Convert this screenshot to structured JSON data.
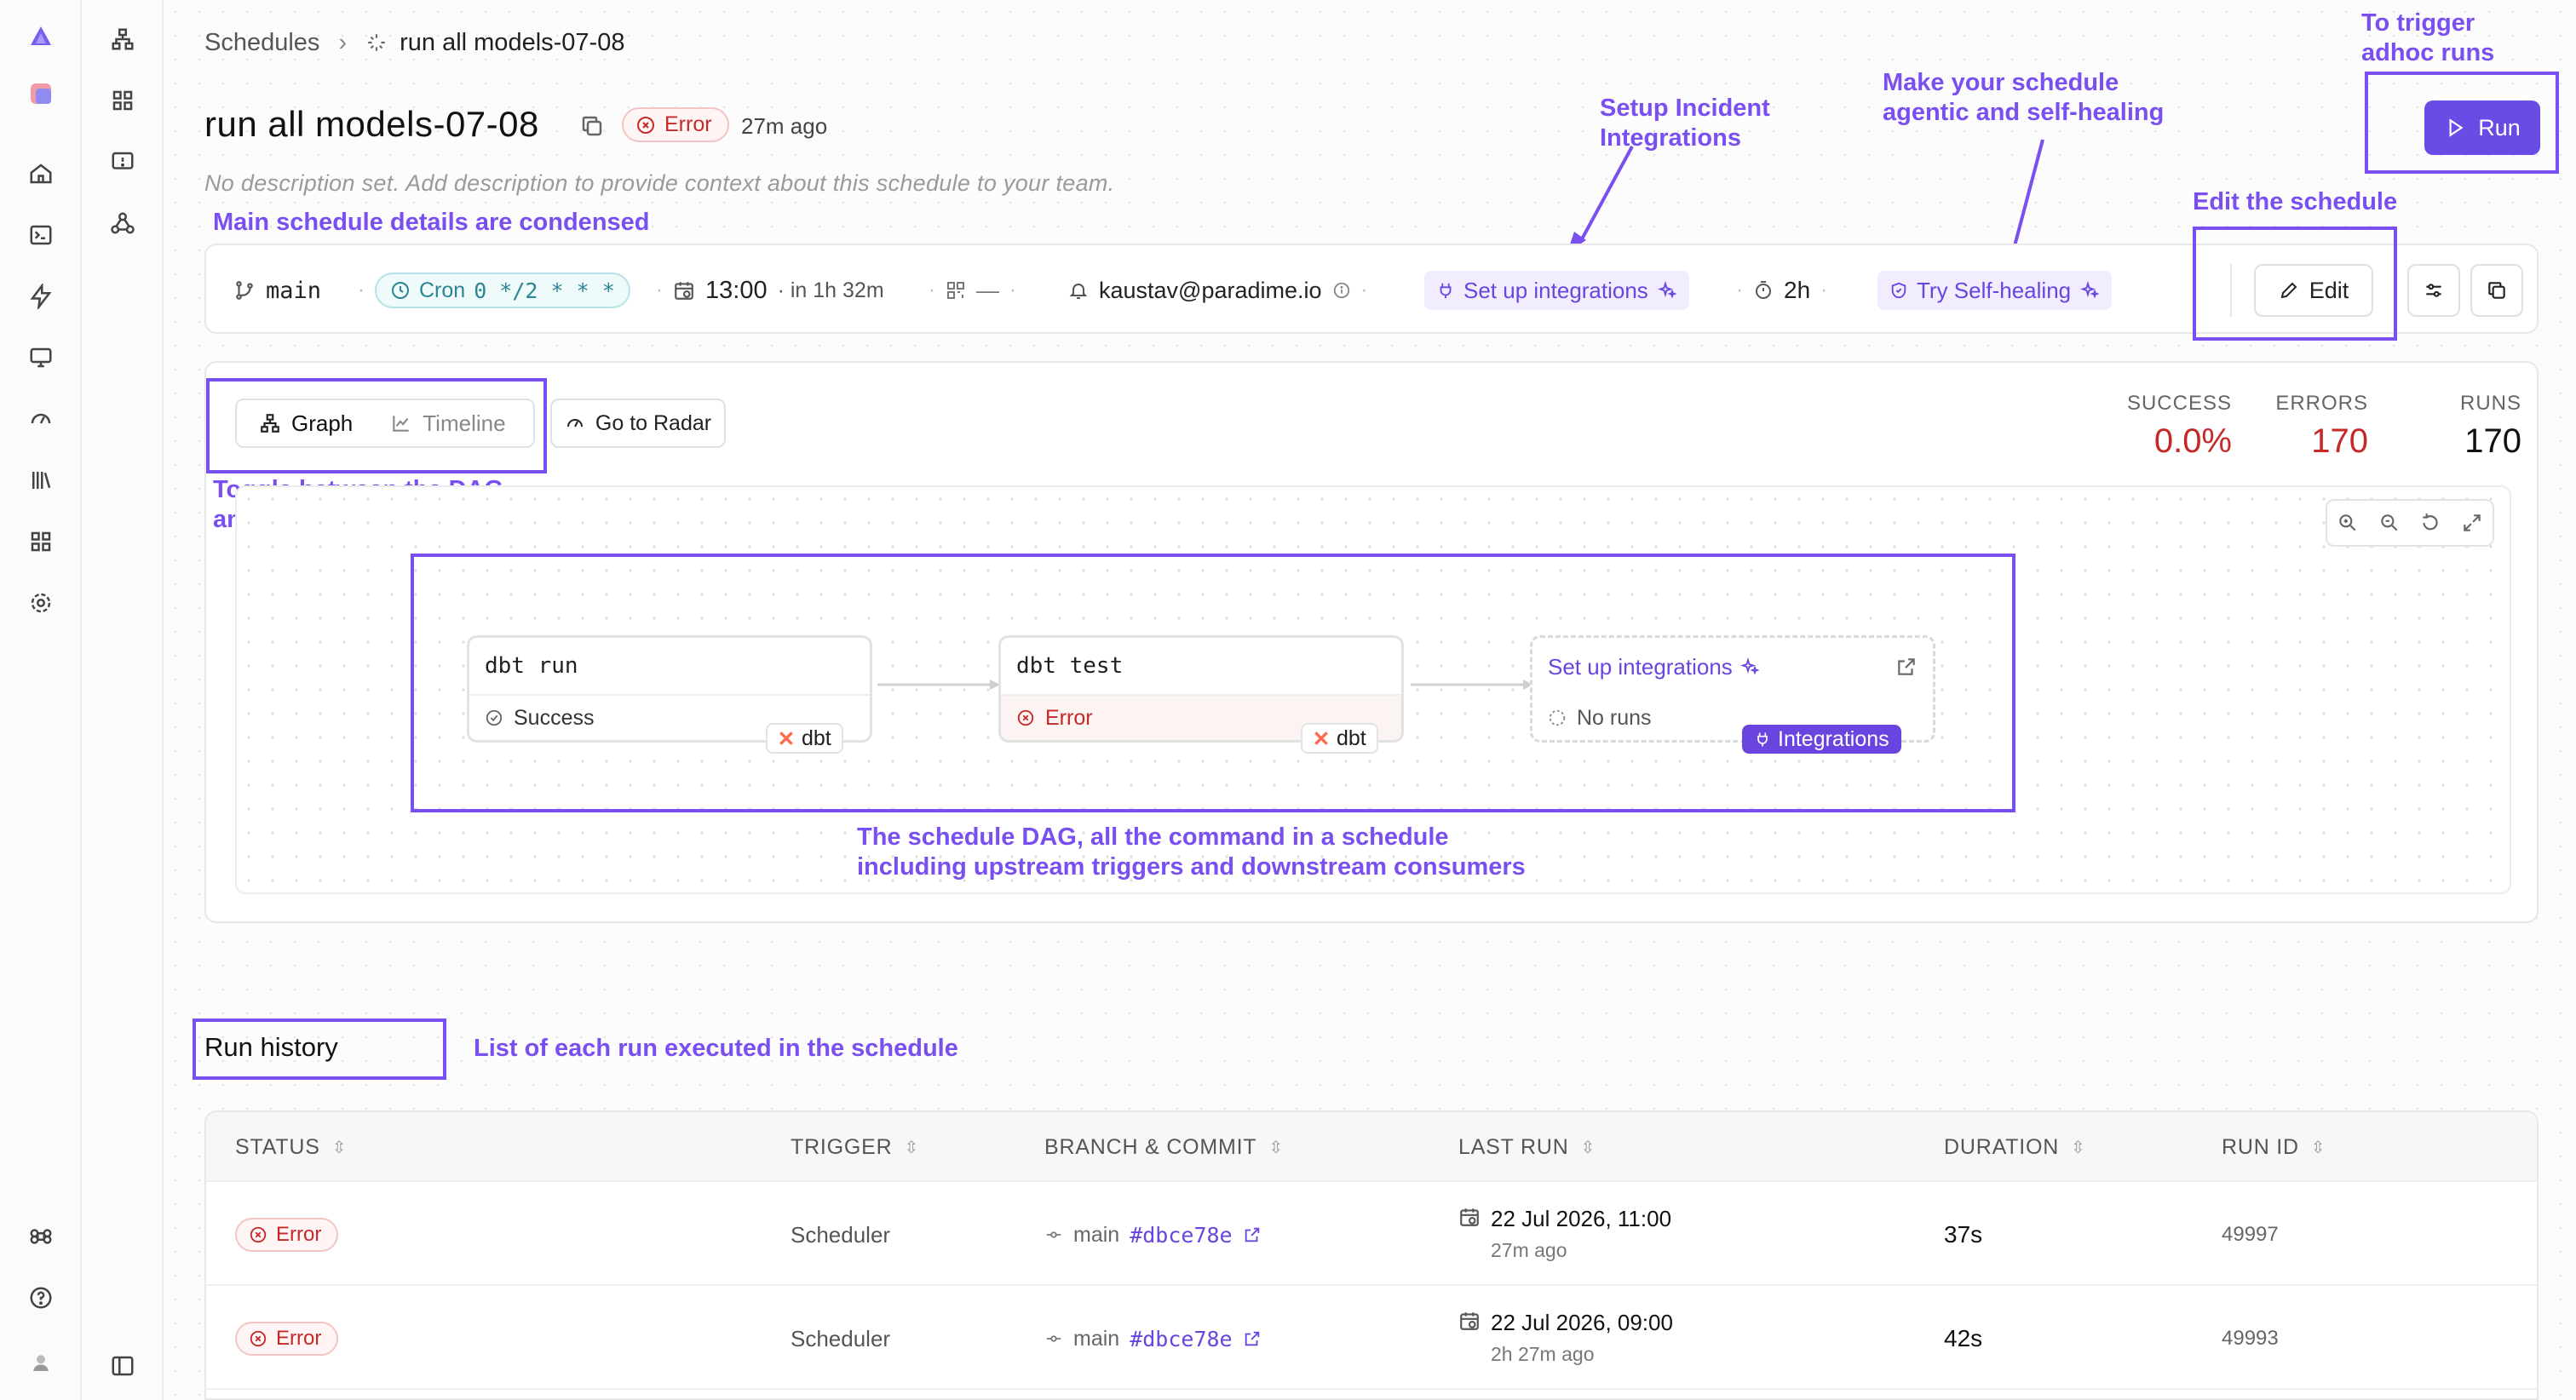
{
  "breadcrumb": {
    "root": "Schedules",
    "current": "run all models-07-08"
  },
  "header": {
    "title": "run all models-07-08",
    "status": "Error",
    "ago": "27m ago",
    "description": "No description set. Add description to provide context about this schedule to your team.",
    "run_label": "Run"
  },
  "details": {
    "branch": "main",
    "cron_label": "Cron",
    "cron_expr": "0 */2 * * *",
    "time": "13:00",
    "next": "· in 1h 32m",
    "commit": "—",
    "owner": "kaustav@paradime.io",
    "integrations": "Set up integrations",
    "timeout": "2h",
    "self_healing": "Try Self-healing",
    "edit_label": "Edit"
  },
  "graph": {
    "toggle_graph": "Graph",
    "toggle_timeline": "Timeline",
    "radar": "Go to Radar",
    "stats": [
      {
        "label": "SUCCESS",
        "value": "0.0%",
        "color": "#c62828"
      },
      {
        "label": "ERRORS",
        "value": "170",
        "color": "#c62828"
      },
      {
        "label": "RUNS",
        "value": "170",
        "color": "#111111"
      }
    ],
    "nodes": [
      {
        "title": "dbt run",
        "status": "Success",
        "tag": "dbt"
      },
      {
        "title": "dbt test",
        "status": "Error",
        "tag": "dbt"
      },
      {
        "title": "Set up integrations",
        "status": "No runs",
        "tag": "Integrations"
      }
    ]
  },
  "annotations": {
    "trigger": "To trigger\nadhoc runs",
    "incident": "Setup Incident\nIntegrations",
    "agentic": "Make your schedule\nagentic and self-healing",
    "edit": "Edit the schedule",
    "condensed": "Main schedule details are condensed",
    "toggle": "Toggle between the DAG\nand execution time view",
    "dag": "The schedule DAG, all the command in a schedule\nincluding upstream triggers and downstream consumers",
    "history_desc": "List of each run executed in the schedule"
  },
  "run_history": {
    "title": "Run history",
    "columns": [
      "STATUS",
      "TRIGGER",
      "BRANCH & COMMIT",
      "LAST RUN",
      "DURATION",
      "RUN ID"
    ],
    "rows": [
      {
        "status": "Error",
        "trigger": "Scheduler",
        "branch": "main",
        "commit": "#dbce78e",
        "last_run": "22 Jul 2026, 11:00",
        "last_run_ago": "27m ago",
        "duration": "37s",
        "run_id": "49997"
      },
      {
        "status": "Error",
        "trigger": "Scheduler",
        "branch": "main",
        "commit": "#dbce78e",
        "last_run": "22 Jul 2026, 09:00",
        "last_run_ago": "2h 27m ago",
        "duration": "42s",
        "run_id": "49993"
      }
    ]
  },
  "colors": {
    "accent": "#6a4be6",
    "annotation": "#7a4ff0",
    "error": "#c62828"
  }
}
